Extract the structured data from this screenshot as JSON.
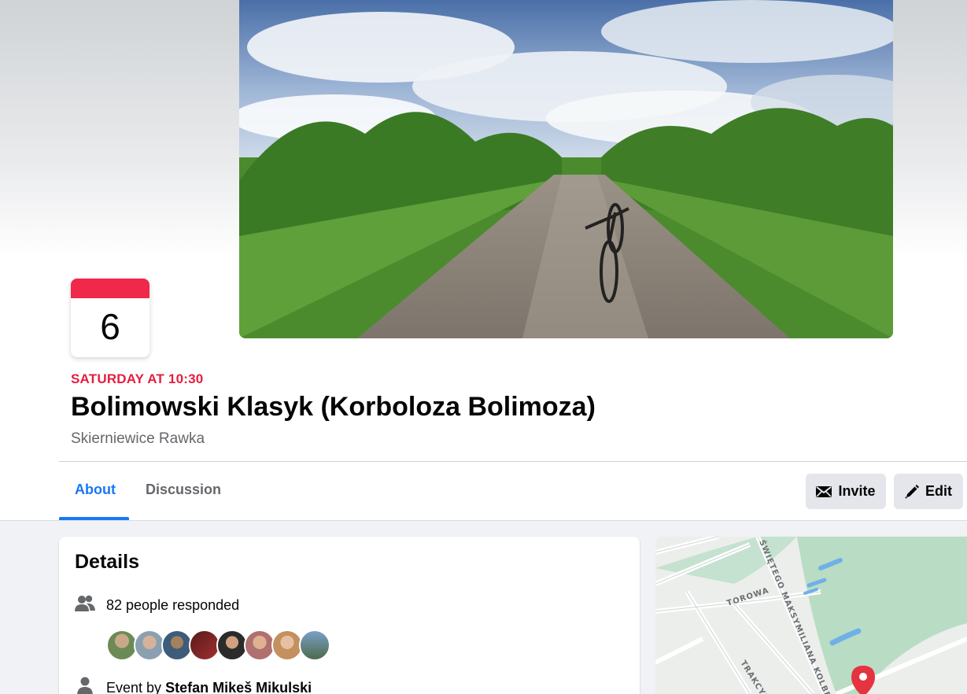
{
  "event": {
    "date_day": "6",
    "time": "SATURDAY AT 10:30",
    "title": "Bolimowski Klasyk (Korboloza Bolimoza)",
    "location": "Skierniewice Rawka"
  },
  "tabs": [
    {
      "label": "About",
      "active": true
    },
    {
      "label": "Discussion",
      "active": false
    }
  ],
  "actions": {
    "invite_label": "Invite",
    "edit_label": "Edit"
  },
  "details": {
    "title": "Details",
    "responded": "82 people responded",
    "event_by_prefix": "Event by",
    "host": "Stefan Mikeš Mikulski"
  },
  "map": {
    "street_1": "TOROWA",
    "street_2": "ŚWIĘTEGO MAKSYMILIANA KOLBE",
    "street_3": "TRAKCYJNA"
  },
  "colors": {
    "accent": "#1877f2",
    "date_red": "#e41e3f",
    "badge_red": "#f02849"
  }
}
